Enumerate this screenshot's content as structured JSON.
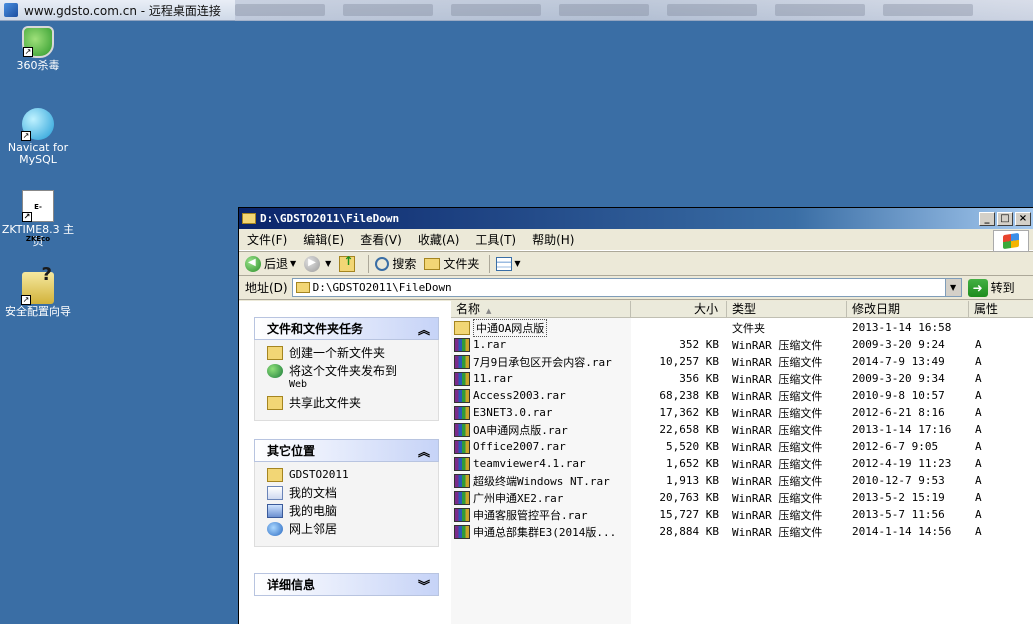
{
  "remote_bar": {
    "title": "www.gdsto.com.cn - 远程桌面连接"
  },
  "desktop_icons": [
    {
      "label": "360杀毒"
    },
    {
      "label": "Navicat for MySQL"
    },
    {
      "label": "ZKTIME8.3 主页"
    },
    {
      "label": "安全配置向导"
    }
  ],
  "window": {
    "title": "D:\\GDSTO2011\\FileDown",
    "menu": [
      "文件(F)",
      "编辑(E)",
      "查看(V)",
      "收藏(A)",
      "工具(T)",
      "帮助(H)"
    ],
    "toolbar": {
      "back": "后退",
      "search": "搜索",
      "folders": "文件夹"
    },
    "address": {
      "label": "地址(D)",
      "value": "D:\\GDSTO2011\\FileDown",
      "go": "转到"
    }
  },
  "left_pane": {
    "tasks": {
      "header": "文件和文件夹任务",
      "items": [
        "创建一个新文件夹",
        "将这个文件夹发布到",
        "Web",
        "共享此文件夹"
      ]
    },
    "places": {
      "header": "其它位置",
      "items": [
        "GDSTO2011",
        "我的文档",
        "我的电脑",
        "网上邻居"
      ]
    },
    "details": {
      "header": "详细信息"
    }
  },
  "file_list": {
    "columns": [
      "名称",
      "大小",
      "类型",
      "修改日期",
      "属性"
    ],
    "rows": [
      {
        "name": "中通OA网点版",
        "size": "",
        "type": "文件夹",
        "date": "2013-1-14 16:58",
        "attr": "",
        "kind": "folder"
      },
      {
        "name": "1.rar",
        "size": "352 KB",
        "type": "WinRAR 压缩文件",
        "date": "2009-3-20 9:24",
        "attr": "A",
        "kind": "rar"
      },
      {
        "name": "7月9日承包区开会内容.rar",
        "size": "10,257 KB",
        "type": "WinRAR 压缩文件",
        "date": "2014-7-9 13:49",
        "attr": "A",
        "kind": "rar"
      },
      {
        "name": "11.rar",
        "size": "356 KB",
        "type": "WinRAR 压缩文件",
        "date": "2009-3-20 9:34",
        "attr": "A",
        "kind": "rar"
      },
      {
        "name": "Access2003.rar",
        "size": "68,238 KB",
        "type": "WinRAR 压缩文件",
        "date": "2010-9-8 10:57",
        "attr": "A",
        "kind": "rar"
      },
      {
        "name": "E3NET3.0.rar",
        "size": "17,362 KB",
        "type": "WinRAR 压缩文件",
        "date": "2012-6-21 8:16",
        "attr": "A",
        "kind": "rar"
      },
      {
        "name": "OA申通网点版.rar",
        "size": "22,658 KB",
        "type": "WinRAR 压缩文件",
        "date": "2013-1-14 17:16",
        "attr": "A",
        "kind": "rar"
      },
      {
        "name": "Office2007.rar",
        "size": "5,520 KB",
        "type": "WinRAR 压缩文件",
        "date": "2012-6-7 9:05",
        "attr": "A",
        "kind": "rar"
      },
      {
        "name": "teamviewer4.1.rar",
        "size": "1,652 KB",
        "type": "WinRAR 压缩文件",
        "date": "2012-4-19 11:23",
        "attr": "A",
        "kind": "rar"
      },
      {
        "name": "超级终端Windows NT.rar",
        "size": "1,913 KB",
        "type": "WinRAR 压缩文件",
        "date": "2010-12-7 9:53",
        "attr": "A",
        "kind": "rar"
      },
      {
        "name": "广州申通XE2.rar",
        "size": "20,763 KB",
        "type": "WinRAR 压缩文件",
        "date": "2013-5-2 15:19",
        "attr": "A",
        "kind": "rar"
      },
      {
        "name": "申通客服管控平台.rar",
        "size": "15,727 KB",
        "type": "WinRAR 压缩文件",
        "date": "2013-5-7 11:56",
        "attr": "A",
        "kind": "rar"
      },
      {
        "name": "申通总部集群E3(2014版...",
        "size": "28,884 KB",
        "type": "WinRAR 压缩文件",
        "date": "2014-1-14 14:56",
        "attr": "A",
        "kind": "rar"
      }
    ]
  }
}
